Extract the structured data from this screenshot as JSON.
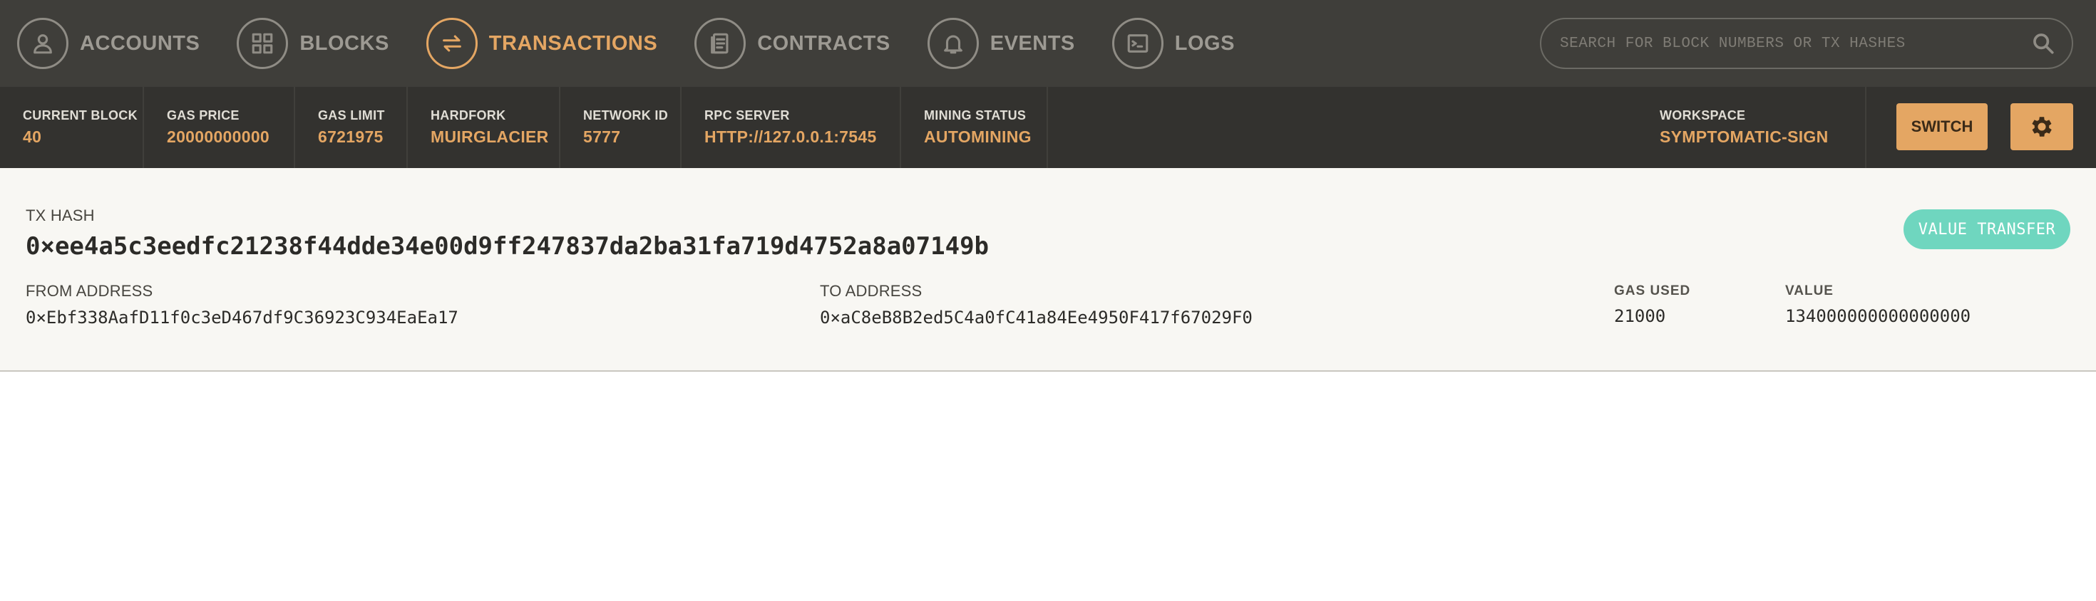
{
  "nav": {
    "items": [
      {
        "label": "ACCOUNTS",
        "icon": "user-icon"
      },
      {
        "label": "BLOCKS",
        "icon": "grid-icon"
      },
      {
        "label": "TRANSACTIONS",
        "icon": "swap-arrows-icon",
        "active": true
      },
      {
        "label": "CONTRACTS",
        "icon": "document-icon"
      },
      {
        "label": "EVENTS",
        "icon": "bell-icon"
      },
      {
        "label": "LOGS",
        "icon": "terminal-icon"
      }
    ],
    "search_placeholder": "SEARCH FOR BLOCK NUMBERS OR TX HASHES"
  },
  "status": {
    "current_block": {
      "label": "CURRENT BLOCK",
      "value": "40"
    },
    "gas_price": {
      "label": "GAS PRICE",
      "value": "20000000000"
    },
    "gas_limit": {
      "label": "GAS LIMIT",
      "value": "6721975"
    },
    "hardfork": {
      "label": "HARDFORK",
      "value": "MUIRGLACIER"
    },
    "network_id": {
      "label": "NETWORK ID",
      "value": "5777"
    },
    "rpc_server": {
      "label": "RPC SERVER",
      "value": "HTTP://127.0.0.1:7545"
    },
    "mining_status": {
      "label": "MINING STATUS",
      "value": "AUTOMINING"
    },
    "workspace": {
      "label": "WORKSPACE",
      "value": "SYMPTOMATIC-SIGN"
    },
    "switch_label": "SWITCH"
  },
  "transaction": {
    "hash_label": "TX HASH",
    "hash": "0×ee4a5c3eedfc21238f44dde34e00d9ff247837da2ba31fa719d4752a8a07149b",
    "type_badge": "VALUE TRANSFER",
    "from_label": "FROM ADDRESS",
    "from": "0×Ebf338AafD11f0c3eD467df9C36923C934EaEa17",
    "to_label": "TO ADDRESS",
    "to": "0×aC8eB8B2ed5C4a0fC41a84Ee4950F417f67029F0",
    "gas_used_label": "GAS USED",
    "gas_used": "21000",
    "value_label": "VALUE",
    "value": "134000000000000000"
  },
  "colors": {
    "accent": "#e4a663",
    "nav_bg": "#3f3e3a",
    "status_bg": "#33322f",
    "badge": "#6fd6bf"
  }
}
